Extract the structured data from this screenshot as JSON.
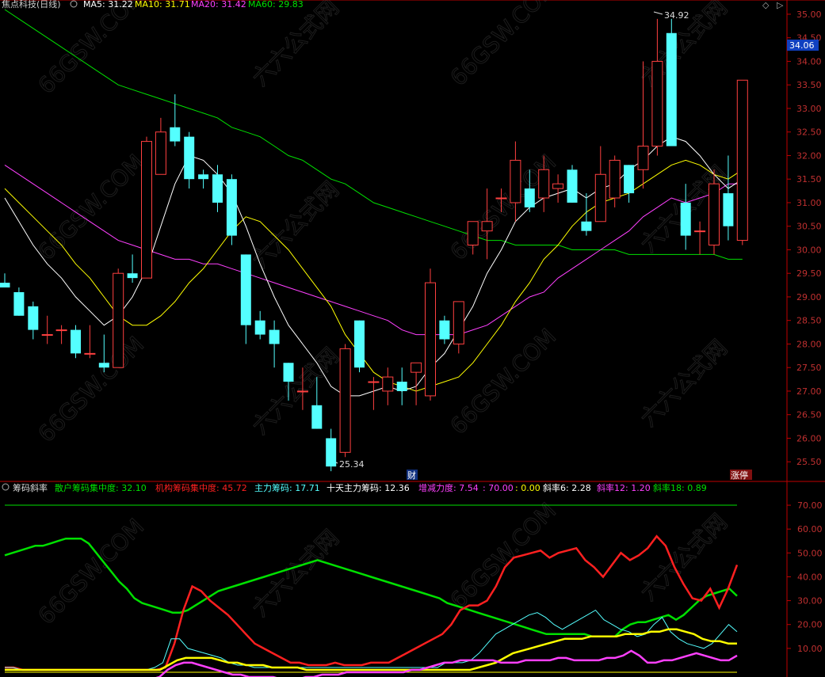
{
  "colors": {
    "up": "#ff4040",
    "down": "#54ffff",
    "ma5": "#ffffff",
    "ma10": "#ffff00",
    "ma20": "#ff40ff",
    "ma60": "#00e000",
    "axis": "#c00000",
    "grid": "#4a0000",
    "retail": "#00e000",
    "inst": "#ff2020",
    "main": "#54ffff",
    "main10": "#ffff00",
    "incdec": "#ff40ff"
  },
  "header": {
    "title": "焦点科技(日线)",
    "ma5": "MA5: 31.22",
    "ma10": "MA10: 31.71",
    "ma20": "MA20: 31.42",
    "ma60": "MA60: 29.83"
  },
  "indicator_header": {
    "name": "筹码斜率",
    "retail": "散户筹码集中度: 32.10",
    "inst": "机构筹码集中度: 45.72",
    "main": "主力筹码: 17.71",
    "main10": "十天主力筹码: 12.36",
    "incdec": "增减力度: 7.54",
    "v70": ": 70.00",
    "v0": ": 0.00",
    "slope6": "斜率6: 2.28",
    "slope12": "斜率12: 1.20",
    "slope18": "斜率18: 0.89"
  },
  "annotations": {
    "high": "34.92",
    "low": "25.34",
    "current_price": "34.06",
    "marker_cai": "财",
    "marker_zhangting": "涨停"
  },
  "chart_data": [
    {
      "type": "candlestick",
      "title": "焦点科技(日线)",
      "ylim": [
        25.1,
        35.1
      ],
      "yticks": [
        "25.50",
        "26.00",
        "26.50",
        "27.00",
        "27.50",
        "28.00",
        "28.50",
        "29.00",
        "29.50",
        "30.00",
        "30.50",
        "31.00",
        "31.50",
        "32.00",
        "32.50",
        "33.00",
        "33.50",
        "34.00",
        "34.50",
        "35.00"
      ],
      "candles": [
        [
          29.3,
          29.5,
          29.2,
          29.2
        ],
        [
          29.1,
          29.2,
          28.6,
          28.6
        ],
        [
          28.8,
          28.9,
          28.1,
          28.3
        ],
        [
          28.2,
          28.6,
          28.0,
          28.2
        ],
        [
          28.3,
          28.4,
          28.0,
          28.3
        ],
        [
          28.3,
          28.4,
          27.7,
          27.8
        ],
        [
          27.8,
          28.4,
          27.7,
          27.8
        ],
        [
          27.6,
          28.2,
          27.4,
          27.5
        ],
        [
          27.5,
          29.6,
          27.5,
          29.5
        ],
        [
          29.5,
          29.9,
          29.3,
          29.4
        ],
        [
          29.4,
          32.4,
          29.4,
          32.3
        ],
        [
          31.6,
          32.8,
          31.6,
          32.5
        ],
        [
          32.6,
          33.3,
          32.2,
          32.3
        ],
        [
          32.4,
          32.5,
          31.3,
          31.5
        ],
        [
          31.6,
          31.7,
          31.3,
          31.5
        ],
        [
          31.6,
          31.8,
          30.8,
          31.0
        ],
        [
          31.5,
          31.6,
          30.1,
          30.3
        ],
        [
          29.9,
          29.9,
          28.0,
          28.4
        ],
        [
          28.5,
          28.7,
          28.1,
          28.2
        ],
        [
          28.3,
          28.5,
          27.5,
          28.0
        ],
        [
          27.6,
          27.6,
          26.8,
          27.2
        ],
        [
          27.0,
          27.5,
          26.6,
          27.0
        ],
        [
          26.7,
          27.3,
          26.2,
          26.2
        ],
        [
          26.0,
          26.2,
          25.3,
          25.4
        ],
        [
          25.7,
          28.0,
          25.6,
          27.9
        ],
        [
          28.5,
          28.5,
          27.4,
          27.5
        ],
        [
          27.2,
          27.3,
          26.6,
          27.2
        ],
        [
          27.0,
          27.5,
          26.7,
          27.3
        ],
        [
          27.2,
          27.5,
          26.7,
          27.0
        ],
        [
          27.4,
          27.5,
          26.7,
          27.6
        ],
        [
          26.9,
          29.6,
          26.8,
          29.3
        ],
        [
          28.5,
          28.6,
          28.0,
          28.1
        ],
        [
          28.0,
          28.9,
          27.8,
          28.9
        ],
        [
          30.1,
          30.6,
          29.9,
          30.6
        ],
        [
          30.4,
          31.3,
          29.8,
          30.6
        ],
        [
          31.1,
          31.3,
          30.8,
          31.1
        ],
        [
          31.0,
          32.3,
          30.6,
          31.9
        ],
        [
          31.3,
          31.7,
          30.8,
          30.9
        ],
        [
          31.1,
          32.0,
          30.8,
          31.7
        ],
        [
          31.3,
          31.6,
          31.0,
          31.4
        ],
        [
          31.7,
          31.8,
          31.0,
          31.0
        ],
        [
          30.6,
          31.2,
          30.3,
          30.4
        ],
        [
          30.6,
          32.2,
          30.6,
          31.6
        ],
        [
          31.1,
          32.0,
          30.9,
          31.9
        ],
        [
          31.8,
          31.8,
          31.0,
          31.2
        ],
        [
          31.7,
          34.0,
          31.3,
          32.2
        ],
        [
          32.2,
          34.9,
          32.0,
          34.0
        ],
        [
          34.6,
          34.9,
          32.2,
          32.2
        ],
        [
          31.0,
          31.4,
          30.0,
          30.3
        ],
        [
          30.4,
          30.6,
          29.9,
          30.4
        ],
        [
          30.1,
          31.7,
          29.9,
          31.4
        ],
        [
          31.2,
          32.0,
          30.2,
          30.5
        ],
        [
          30.2,
          33.6,
          30.1,
          33.6
        ]
      ],
      "ma5": [
        31.1,
        30.6,
        30.1,
        29.7,
        29.4,
        29.0,
        28.7,
        28.4,
        28.6,
        29.0,
        29.6,
        30.5,
        31.4,
        32.0,
        31.9,
        31.6,
        31.2,
        30.5,
        29.7,
        29.0,
        28.4,
        28.0,
        27.6,
        27.1,
        26.9,
        26.9,
        27.0,
        27.1,
        27.0,
        27.1,
        27.5,
        27.8,
        28.3,
        28.8,
        29.5,
        30.0,
        30.6,
        30.9,
        31.1,
        31.2,
        31.3,
        31.1,
        31.3,
        31.4,
        31.7,
        31.9,
        32.2,
        32.4,
        32.3,
        32.0,
        31.6,
        31.3,
        31.5
      ],
      "ma10": [
        31.3,
        31.0,
        30.7,
        30.4,
        30.1,
        29.7,
        29.4,
        29.0,
        28.6,
        28.4,
        28.4,
        28.6,
        28.9,
        29.3,
        29.6,
        30.0,
        30.4,
        30.7,
        30.6,
        30.3,
        30.0,
        29.6,
        29.2,
        28.8,
        28.2,
        27.8,
        27.4,
        27.2,
        27.1,
        27.0,
        27.1,
        27.2,
        27.3,
        27.6,
        28.0,
        28.4,
        28.9,
        29.3,
        29.8,
        30.1,
        30.5,
        30.8,
        31.0,
        31.1,
        31.2,
        31.4,
        31.6,
        31.8,
        31.9,
        31.8,
        31.6,
        31.5,
        31.7
      ],
      "ma20": [
        31.8,
        31.6,
        31.4,
        31.2,
        31.0,
        30.8,
        30.6,
        30.4,
        30.2,
        30.1,
        30.0,
        29.9,
        29.8,
        29.8,
        29.7,
        29.7,
        29.6,
        29.5,
        29.4,
        29.3,
        29.2,
        29.1,
        29.0,
        28.9,
        28.8,
        28.7,
        28.6,
        28.5,
        28.3,
        28.2,
        28.2,
        28.2,
        28.2,
        28.3,
        28.4,
        28.6,
        28.8,
        29.0,
        29.1,
        29.4,
        29.6,
        29.8,
        30.0,
        30.2,
        30.4,
        30.7,
        30.9,
        31.1,
        31.0,
        31.1,
        31.2,
        31.4,
        31.4
      ],
      "ma60": [
        35.1,
        34.9,
        34.7,
        34.5,
        34.3,
        34.1,
        33.9,
        33.7,
        33.5,
        33.4,
        33.3,
        33.2,
        33.1,
        33.0,
        32.9,
        32.8,
        32.6,
        32.5,
        32.4,
        32.2,
        32.0,
        31.9,
        31.7,
        31.5,
        31.4,
        31.2,
        31.0,
        30.9,
        30.8,
        30.7,
        30.6,
        30.5,
        30.4,
        30.3,
        30.2,
        30.2,
        30.1,
        30.1,
        30.1,
        30.1,
        30.0,
        30.0,
        30.0,
        30.0,
        29.9,
        29.9,
        29.9,
        29.9,
        29.9,
        29.9,
        29.9,
        29.8,
        29.8
      ]
    },
    {
      "type": "line",
      "title": "筹码斜率",
      "ylim": [
        0,
        73
      ],
      "yticks": [
        "10.00",
        "20.00",
        "30.00",
        "40.00",
        "50.00",
        "60.00",
        "70.00"
      ],
      "series": [
        {
          "name": "散户筹码集中度",
          "values": [
            49,
            50,
            51,
            52,
            53,
            53,
            54,
            55,
            56,
            56,
            56,
            54,
            50,
            46,
            42,
            38,
            35,
            31,
            29,
            28,
            27,
            26,
            25,
            25,
            26,
            28,
            30,
            32,
            34,
            35,
            36,
            37,
            38,
            39,
            40,
            41,
            42,
            43,
            44,
            45,
            46,
            47,
            46,
            45,
            44,
            43,
            42,
            41,
            40,
            39,
            38,
            37,
            36,
            35,
            34,
            33,
            32,
            31,
            29,
            28,
            27,
            26,
            25,
            24,
            23,
            22,
            21,
            20,
            19,
            18,
            17,
            16,
            16,
            16,
            16,
            16,
            16,
            15,
            15,
            15,
            15,
            18,
            20,
            21,
            21,
            22,
            23,
            24,
            22,
            24,
            27,
            30,
            32,
            33,
            34,
            35,
            32
          ]
        },
        {
          "name": "机构筹码集中度",
          "values": [
            2,
            2,
            1,
            1,
            1,
            1,
            1,
            1,
            1,
            1,
            1,
            1,
            1,
            1,
            1,
            1,
            1,
            1,
            2,
            12,
            26,
            36,
            34,
            30,
            27,
            24,
            20,
            16,
            12,
            10,
            8,
            6,
            4,
            4,
            3,
            3,
            3,
            4,
            3,
            3,
            3,
            4,
            4,
            4,
            6,
            8,
            10,
            12,
            14,
            16,
            20,
            26,
            28,
            28,
            30,
            36,
            44,
            48,
            49,
            50,
            51,
            48,
            50,
            51,
            52,
            47,
            44,
            40,
            45,
            50,
            47,
            49,
            52,
            57,
            53,
            44,
            37,
            31,
            30,
            35,
            27,
            35,
            45
          ]
        },
        {
          "name": "主力筹码",
          "values": [
            2,
            2,
            1,
            1,
            1,
            1,
            1,
            1,
            1,
            1,
            1,
            1,
            1,
            1,
            1,
            1,
            1,
            1,
            2,
            4,
            14,
            14,
            10,
            9,
            8,
            7,
            6,
            4,
            3,
            3,
            2,
            2,
            2,
            2,
            2,
            2,
            2,
            2,
            2,
            2,
            2,
            2,
            2,
            2,
            2,
            2,
            2,
            2,
            2,
            2,
            2,
            2,
            2,
            4,
            4,
            4,
            5,
            8,
            12,
            16,
            18,
            20,
            22,
            24,
            25,
            23,
            20,
            18,
            20,
            22,
            24,
            26,
            22,
            20,
            18,
            17,
            15,
            16,
            20,
            23,
            17,
            14,
            12,
            11,
            10,
            12,
            16,
            20,
            17
          ]
        },
        {
          "name": "十天主力筹码",
          "values": [
            1,
            1,
            1,
            1,
            1,
            1,
            1,
            1,
            1,
            1,
            1,
            1,
            1,
            1,
            1,
            1,
            1,
            1,
            1,
            3,
            5,
            6,
            6,
            6,
            6,
            5,
            4,
            4,
            3,
            3,
            3,
            2,
            2,
            2,
            2,
            1,
            1,
            1,
            1,
            1,
            1,
            1,
            1,
            1,
            1,
            1,
            1,
            1,
            1,
            1,
            1,
            1,
            1,
            1,
            1,
            2,
            3,
            4,
            6,
            8,
            9,
            10,
            11,
            12,
            13,
            14,
            14,
            14,
            15,
            15,
            15,
            15,
            16,
            16,
            16,
            17,
            17,
            18,
            18,
            17,
            16,
            14,
            13,
            13,
            12,
            12
          ]
        },
        {
          "name": "增减力度",
          "values": [
            -3,
            -3,
            -3,
            -3,
            -3,
            -3,
            -3,
            -3,
            -3,
            -3,
            -3,
            -3,
            -3,
            -3,
            -3,
            -3,
            -3,
            -3,
            -3,
            -2,
            1,
            3,
            4,
            4,
            3,
            2,
            1,
            0,
            -1,
            -1,
            -2,
            -2,
            -2,
            -2,
            -3,
            -3,
            -3,
            -2,
            -2,
            -1,
            -1,
            -1,
            0,
            0,
            0,
            0,
            0,
            0,
            0,
            0,
            1,
            1,
            2,
            3,
            4,
            4,
            5,
            5,
            5,
            5,
            5,
            4,
            4,
            4,
            5,
            5,
            5,
            5,
            6,
            6,
            5,
            5,
            5,
            5,
            6,
            6,
            7,
            9,
            7,
            4,
            4,
            5,
            5,
            6,
            7,
            8,
            7,
            6,
            5,
            5,
            7
          ]
        },
        {
          "name": "70.00",
          "values": [
            70
          ]
        },
        {
          "name": "0.00",
          "values": [
            0
          ]
        }
      ]
    }
  ]
}
